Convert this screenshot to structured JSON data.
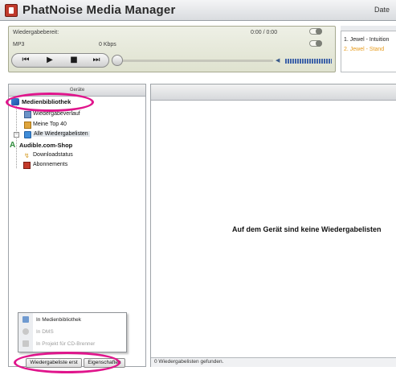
{
  "app": {
    "title": "PhatNoise Media Manager",
    "menu_first": "Date"
  },
  "player": {
    "status": "Wiedergabebereit:",
    "time": "0:00 / 0:00",
    "format": "MP3",
    "bitrate": "0 Kbps",
    "controls": {
      "prev": "⏮",
      "play": "▶",
      "stop": "■",
      "next": "⏭"
    }
  },
  "now_playing": {
    "items": [
      "1. Jewel - Intuition",
      "2. Jewel - Stand"
    ],
    "current_color": "#e79a1a"
  },
  "left_pane": {
    "header": "Geräte",
    "tree": {
      "medien": "Medienbibliothek",
      "verlauf": "Wiedergabeverlauf",
      "top40": "Meine Top 40",
      "alle": "Alle Wiedergabelisten",
      "audible": "Audible.com-Shop",
      "download": "Downloadstatus",
      "abo": "Abonnements"
    }
  },
  "popup_menu": {
    "items": [
      "In Medienbibliothek",
      "In DMS",
      "In Projekt für CD-Brenner"
    ]
  },
  "buttons": {
    "playlist": "Wiedergabeliste erst",
    "properties": "Eigenschaften"
  },
  "right_pane": {
    "empty_message": "Auf dem Gerät sind keine Wiedergabelisten"
  },
  "statusbar": {
    "text": "0 Wiedergabelisten gefunden."
  },
  "colors": {
    "highlight": "#e0158c",
    "player_bg": "#dfe2cf"
  }
}
